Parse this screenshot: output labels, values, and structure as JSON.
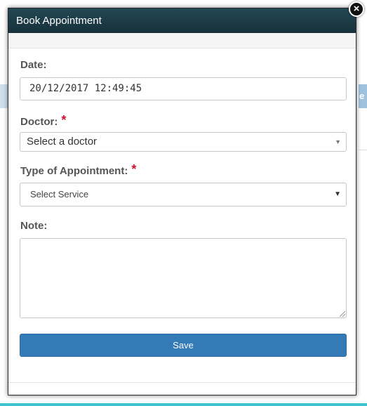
{
  "background": {
    "right_stripe_fragment": "e"
  },
  "modal": {
    "title": "Book Appointment",
    "close_icon": "close-icon"
  },
  "form": {
    "date": {
      "label": "Date:",
      "value": "20/12/2017 12:49:45"
    },
    "doctor": {
      "label": "Doctor:",
      "required_mark": "*",
      "value": "Select a doctor"
    },
    "service": {
      "label": "Type of Appointment:",
      "required_mark": "*",
      "value": "Select Service"
    },
    "note": {
      "label": "Note:",
      "value": ""
    },
    "save_label": "Save"
  },
  "colors": {
    "header_bg": "#1b3a45",
    "primary_button": "#337ab7",
    "required": "#d2122e",
    "accent_bottom": "#3fc1d0"
  }
}
